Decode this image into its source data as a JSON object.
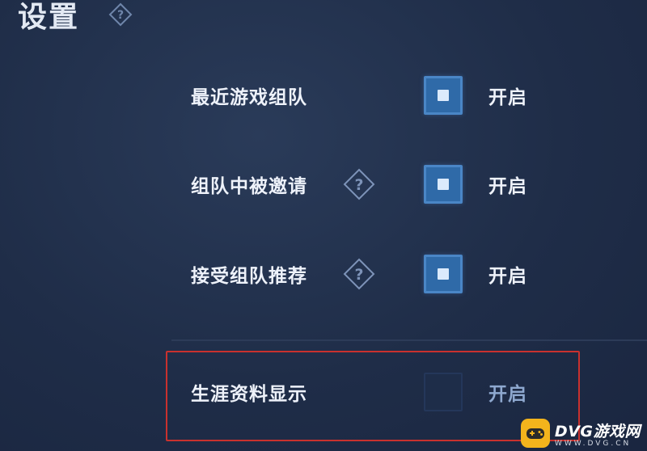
{
  "header": {
    "title": "设置",
    "help_icon": "question-diamond-icon"
  },
  "settings": [
    {
      "label": "最近游戏组队",
      "has_help": false,
      "checked": true,
      "state": "开启"
    },
    {
      "label": "组队中被邀请",
      "has_help": true,
      "checked": true,
      "state": "开启"
    },
    {
      "label": "接受组队推荐",
      "has_help": true,
      "checked": true,
      "state": "开启"
    },
    {
      "label": "生涯资料显示",
      "has_help": false,
      "checked": false,
      "state": "开启",
      "highlighted": true
    }
  ],
  "watermark": {
    "brand": "DVG游戏网",
    "url": "WWW.DVG.CN",
    "icon": "gamepad-icon"
  },
  "colors": {
    "background": "#1f2d48",
    "checkbox_on": "#2f6aa8",
    "checkbox_off": "#1e2d49",
    "highlight_border": "#c9312e",
    "watermark_logo": "#f3b41c"
  }
}
